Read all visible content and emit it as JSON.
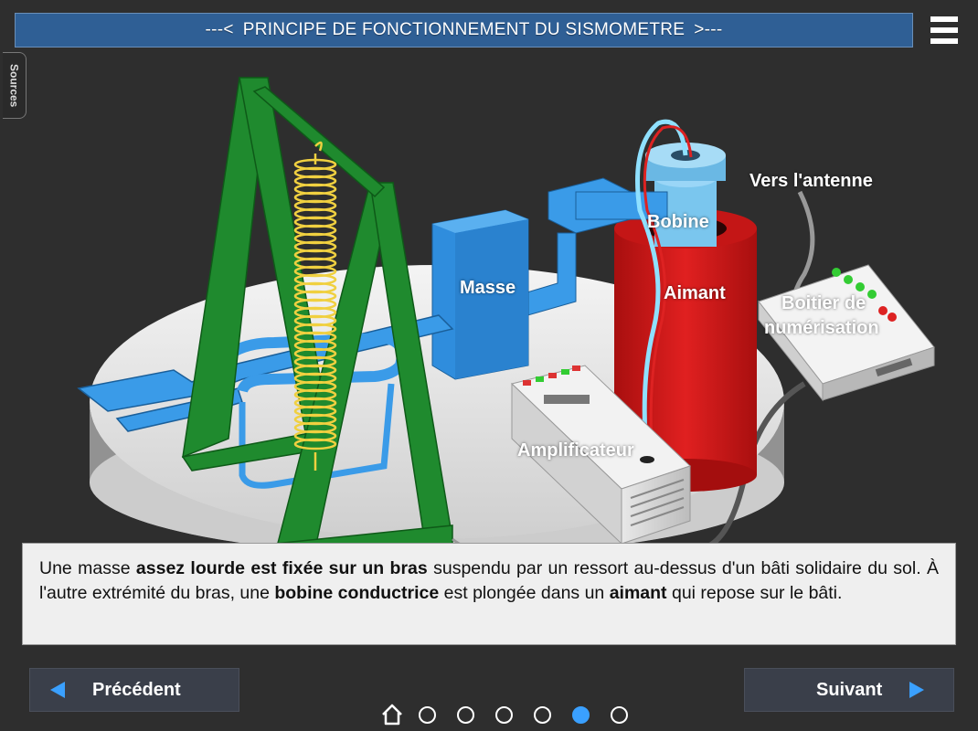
{
  "header": {
    "title": "PRINCIPE DE FONCTIONNEMENT DU SISMOMETRE",
    "left_arrow": "---<",
    "right_arrow": ">---"
  },
  "sources_tab": "Sources",
  "labels": {
    "masse": "Masse",
    "bobine": "Bobine",
    "aimant": "Aimant",
    "antenne": "Vers l'antenne",
    "boitier_line1": "Boitier de",
    "boitier_line2": "numérisation",
    "amplificateur": "Amplificateur"
  },
  "caption": {
    "p1": "Une masse ",
    "b1": "assez lourde est fixée sur un bras",
    "p2": "  suspendu par un ressort au-dessus d'un bâti solidaire du sol. À l'autre extrémité du bras, une ",
    "b2": "bobine conductrice",
    "p3": "  est plongée dans un ",
    "b3": "aimant",
    "p4": " qui repose sur le bâti."
  },
  "nav": {
    "prev_label": "Précédent",
    "next_label": "Suivant"
  },
  "pager": {
    "pages": 6,
    "current": 5
  },
  "colors": {
    "title_bg": "#2f5f95",
    "accent": "#3aa0ff",
    "frame_green": "#1f8a2e",
    "arm_blue": "#3a9be8",
    "magnet_red": "#d11a1a",
    "spring_yellow": "#f0d040"
  },
  "icons": [
    "menu-icon",
    "home-icon",
    "prev-arrow-icon",
    "next-arrow-icon"
  ]
}
